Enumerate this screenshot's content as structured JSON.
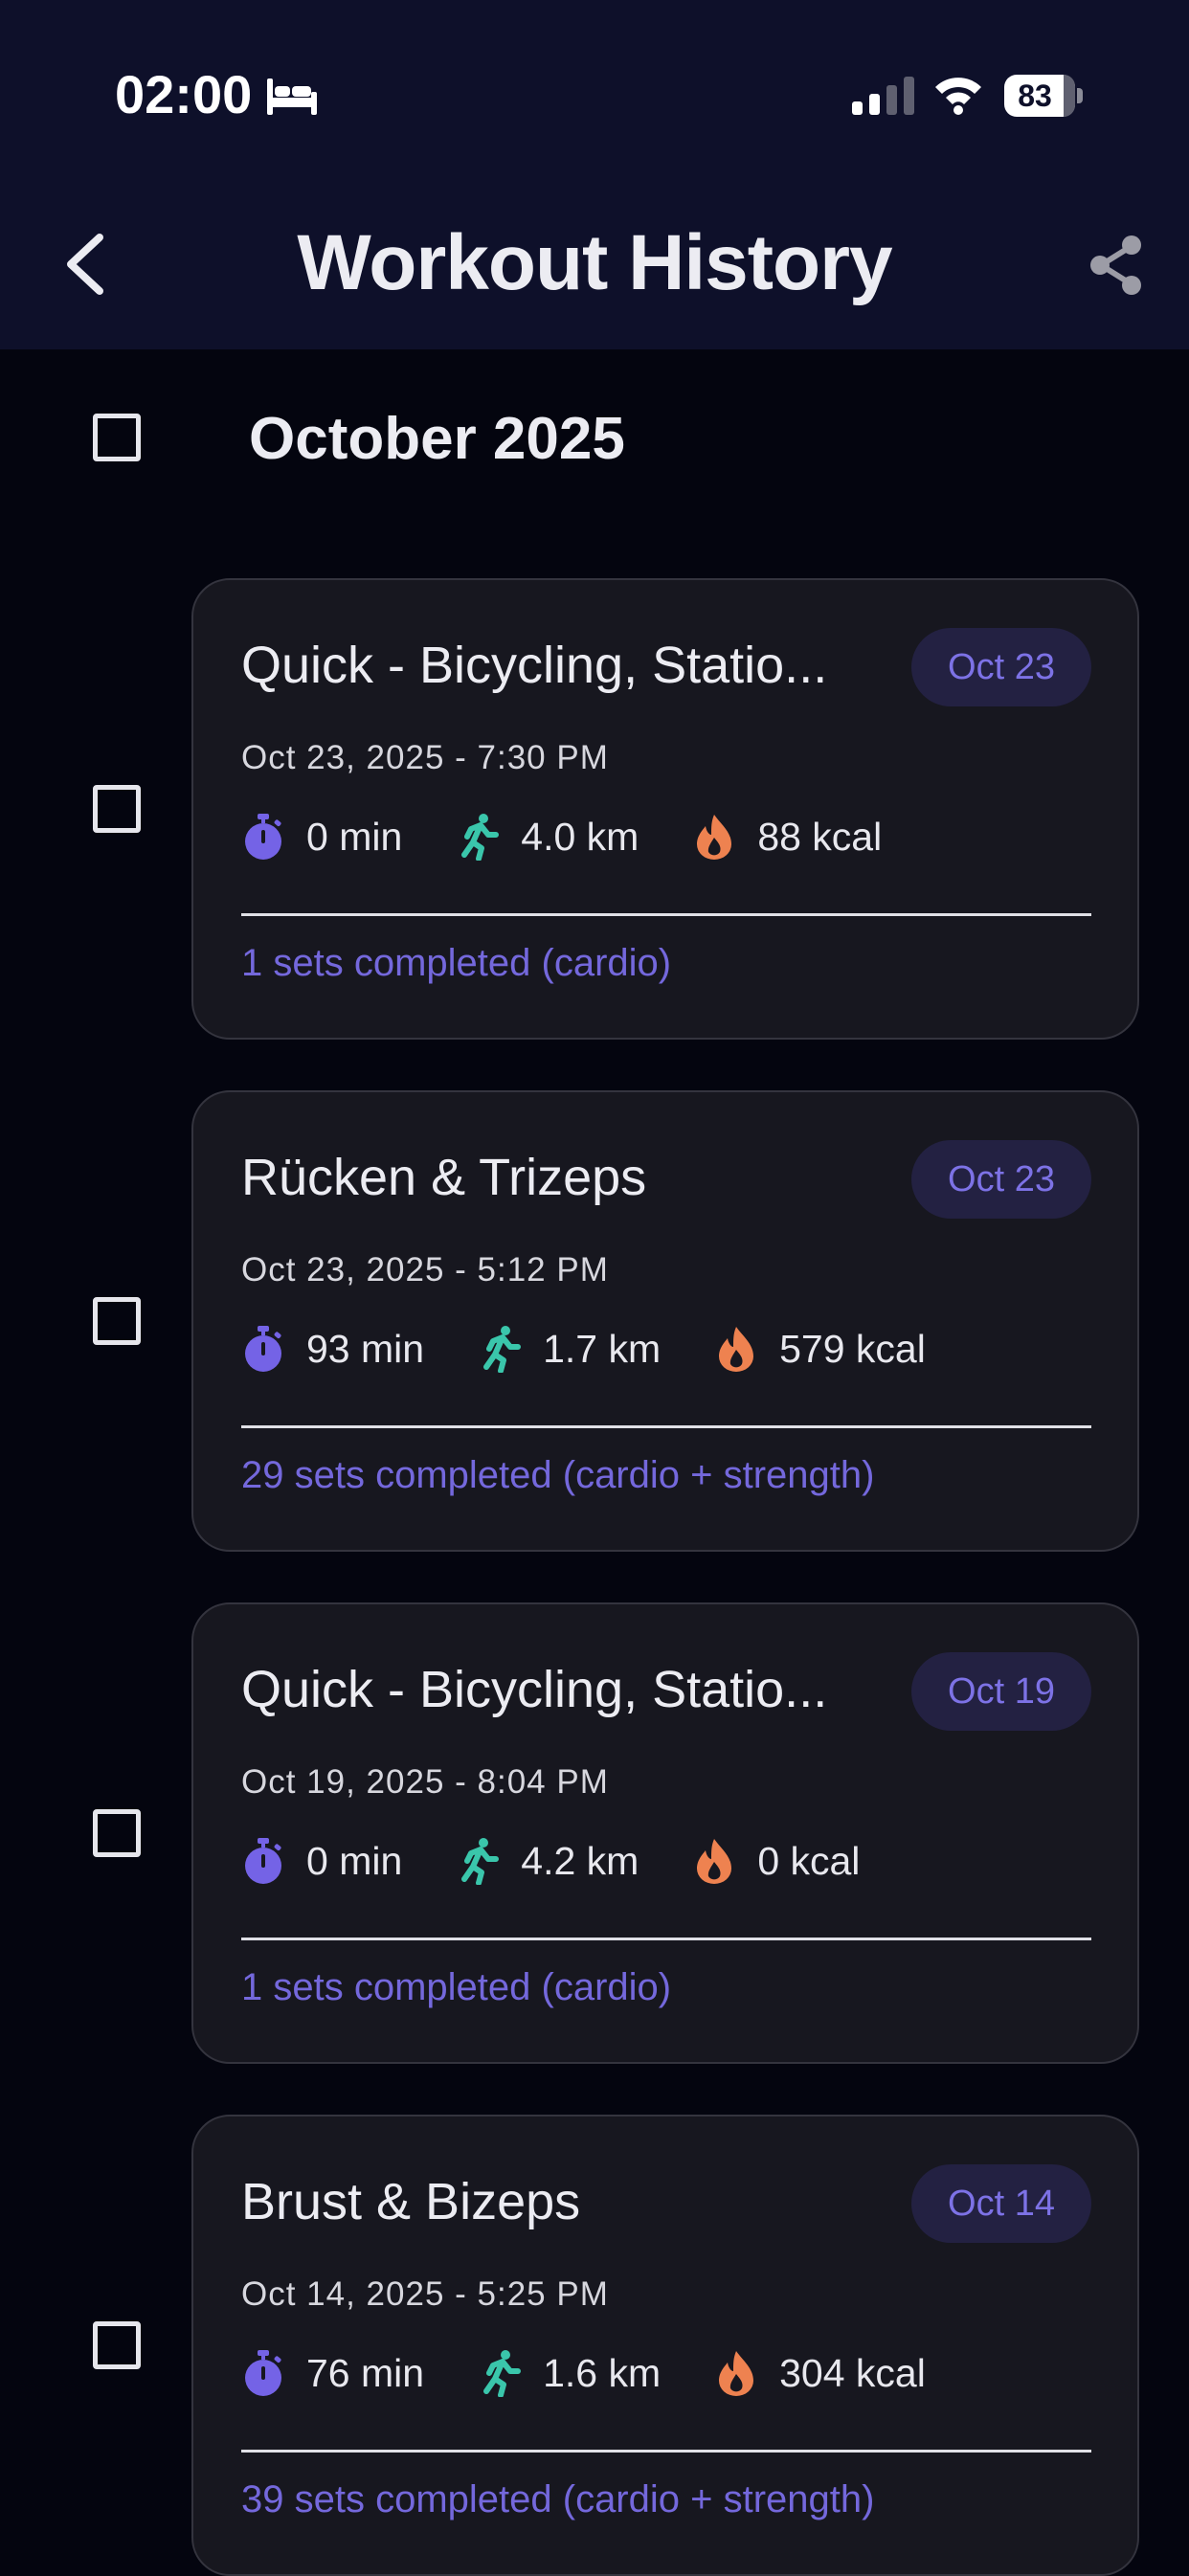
{
  "status_bar": {
    "time": "02:00",
    "battery": "83"
  },
  "header": {
    "title": "Workout History"
  },
  "month": {
    "title": "October 2025"
  },
  "workouts": [
    {
      "title": "Quick - Bicycling, Statio...",
      "badge": "Oct 23",
      "datetime": "Oct 23, 2025 - 7:30 PM",
      "duration": "0 min",
      "distance": "4.0 km",
      "calories": "88 kcal",
      "summary": "1 sets completed (cardio)"
    },
    {
      "title": "Rücken & Trizeps",
      "badge": "Oct 23",
      "datetime": "Oct 23, 2025 - 5:12 PM",
      "duration": "93 min",
      "distance": "1.7 km",
      "calories": "579 kcal",
      "summary": "29 sets completed (cardio + strength)"
    },
    {
      "title": "Quick - Bicycling, Statio...",
      "badge": "Oct 19",
      "datetime": "Oct 19, 2025 - 8:04 PM",
      "duration": "0 min",
      "distance": "4.2 km",
      "calories": "0 kcal",
      "summary": "1 sets completed (cardio)"
    },
    {
      "title": "Brust & Bizeps",
      "badge": "Oct 14",
      "datetime": "Oct 14, 2025 - 5:25 PM",
      "duration": "76 min",
      "distance": "1.6 km",
      "calories": "304 kcal",
      "summary": "39 sets completed (cardio + strength)"
    }
  ],
  "icons": {
    "duration": "stopwatch-icon",
    "distance": "running-person-icon",
    "calories": "flame-icon"
  },
  "colors": {
    "accent": "#7468dc",
    "badge_background": "#232142",
    "stopwatch": "#7463e6",
    "runner": "#3ac6ab",
    "flame": "#ee8250",
    "card_background": "#17171f",
    "header_background": "#0e102a",
    "page_background": "#04050f"
  }
}
